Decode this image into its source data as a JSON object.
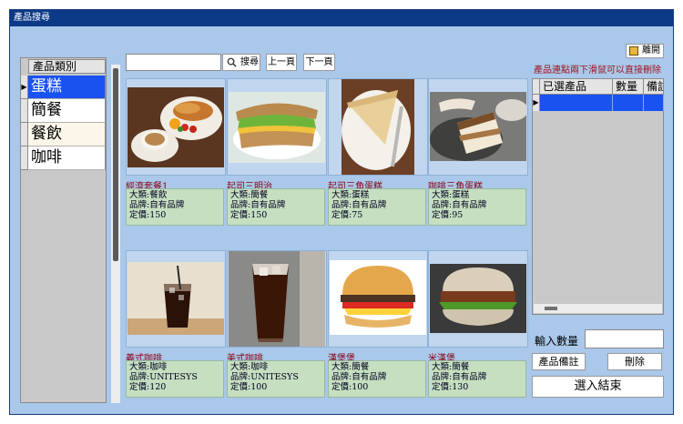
{
  "window": {
    "title": "產品搜尋"
  },
  "categories": {
    "header": "產品類別",
    "items": [
      {
        "label": "蛋糕",
        "selected": true
      },
      {
        "label": "簡餐",
        "selected": false
      },
      {
        "label": "餐飲",
        "selected": false
      },
      {
        "label": "咖啡",
        "selected": false
      }
    ]
  },
  "toolbar": {
    "search_value": "",
    "search_label": "搜尋",
    "prev_label": "上一頁",
    "next_label": "下一頁",
    "exit_label": "離開"
  },
  "hint": "產品連點兩下滑鼠可以直接刪除",
  "products": [
    {
      "name": "經濟套餐1",
      "category": "大類:餐飲",
      "brand": "品牌:自有品牌",
      "price": "定價:150",
      "photo": "breakfast-set-photo"
    },
    {
      "name": "起司三明治",
      "category": "大類:簡餐",
      "brand": "品牌:自有品牌",
      "price": "定價:150",
      "photo": "cheese-sandwich-photo"
    },
    {
      "name": "起司三角蛋糕",
      "category": "大類:蛋糕",
      "brand": "品牌:自有品牌",
      "price": "定價:75",
      "photo": "cheesecake-photo"
    },
    {
      "name": "咖啡三角蛋糕",
      "category": "大類:蛋糕",
      "brand": "品牌:自有品牌",
      "price": "定價:95",
      "photo": "coffee-cake-photo"
    },
    {
      "name": "義式咖啡",
      "category": "大類:咖啡",
      "brand": "品牌:UNITESYS",
      "price": "定價:120",
      "photo": "iced-coffee-photo"
    },
    {
      "name": "美式咖啡",
      "category": "大類:咖啡",
      "brand": "品牌:UNITESYS",
      "price": "定價:100",
      "photo": "americano-photo"
    },
    {
      "name": "漢堡堡",
      "category": "大類:簡餐",
      "brand": "品牌:自有品牌",
      "price": "定價:100",
      "photo": "burger-photo"
    },
    {
      "name": "米漢堡",
      "category": "大類:簡餐",
      "brand": "品牌:自有品牌",
      "price": "定價:130",
      "photo": "rice-burger-photo"
    }
  ],
  "selected_grid": {
    "columns": [
      "已選產品",
      "數量",
      "備註"
    ],
    "rows": []
  },
  "quantity": {
    "label": "輸入數量",
    "value": ""
  },
  "buttons": {
    "note_label": "產品備註",
    "delete_label": "刪除",
    "done_label": "選入結束"
  }
}
